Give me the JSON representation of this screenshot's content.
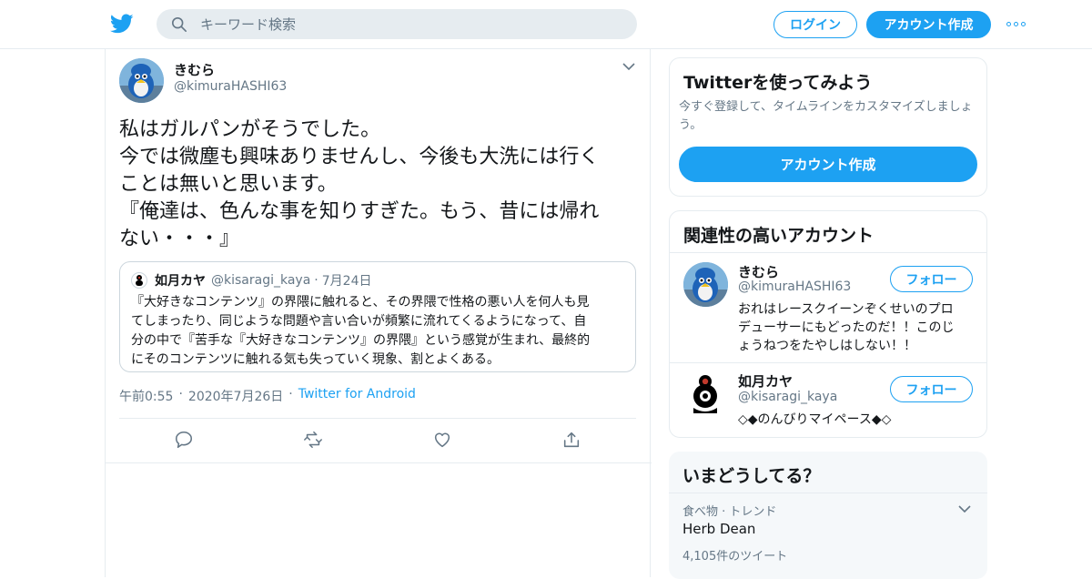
{
  "header": {
    "search_placeholder": "キーワード検索",
    "login_label": "ログイン",
    "signup_label": "アカウント作成"
  },
  "tweet": {
    "author_name": "きむら",
    "author_handle": "@kimuraHASHI63",
    "text_lines": [
      "私はガルパンがそうでした。",
      "今では微塵も興味ありませんし、今後も大洗には行く",
      "ことは無いと思います。",
      "『俺達は、色んな事を知りすぎた。もう、昔には帰れ",
      "ない・・・』"
    ],
    "quote": {
      "name": "如月カヤ",
      "handle": "@kisaragi_kaya",
      "dot": "·",
      "date": "7月24日",
      "lines": [
        "『大好きなコンテンツ』の界隈に触れると、その界隈で性格の悪い人を何人も見",
        "てしまったり、同じような問題や言い合いが頻繁に流れてくるようになって、自",
        "分の中で『苦手な『大好きなコンテンツ』の界隈』という感覚が生まれ、最終的",
        "にそのコンテンツに触れる気も失っていく現象、割とよくある。"
      ]
    },
    "time": "午前0:55",
    "dot": "·",
    "date": "2020年7月26日",
    "source": "Twitter for Android"
  },
  "signup_card": {
    "title": "Twitterを使ってみよう",
    "sub_lines": [
      "今すぐ登録して、タイムラインをカスタマイズしましょ",
      "う。"
    ],
    "button_label": "アカウント作成"
  },
  "related": {
    "title": "関連性の高いアカウント",
    "follow_label": "フォロー",
    "accounts": [
      {
        "name": "きむら",
        "handle": "@kimuraHASHI63",
        "bio_lines": [
          "おれはレースクイーンぞくせいのプロ",
          "デューサーにもどったのだ！！このじ",
          "ょうねつをたやしはしない！！"
        ]
      },
      {
        "name": "如月カヤ",
        "handle": "@kisaragi_kaya",
        "bio_lines": [
          "◇◆のんびりマイペース◆◇"
        ]
      }
    ]
  },
  "trends": {
    "title": "いまどうしてる？",
    "items": [
      {
        "context": "食べ物 · トレンド",
        "name": "Herb Dean",
        "count": "4,105件のツイート"
      }
    ]
  },
  "colors": {
    "accent": "#1da1f2",
    "muted": "#657786",
    "border": "#e6ecf0"
  }
}
